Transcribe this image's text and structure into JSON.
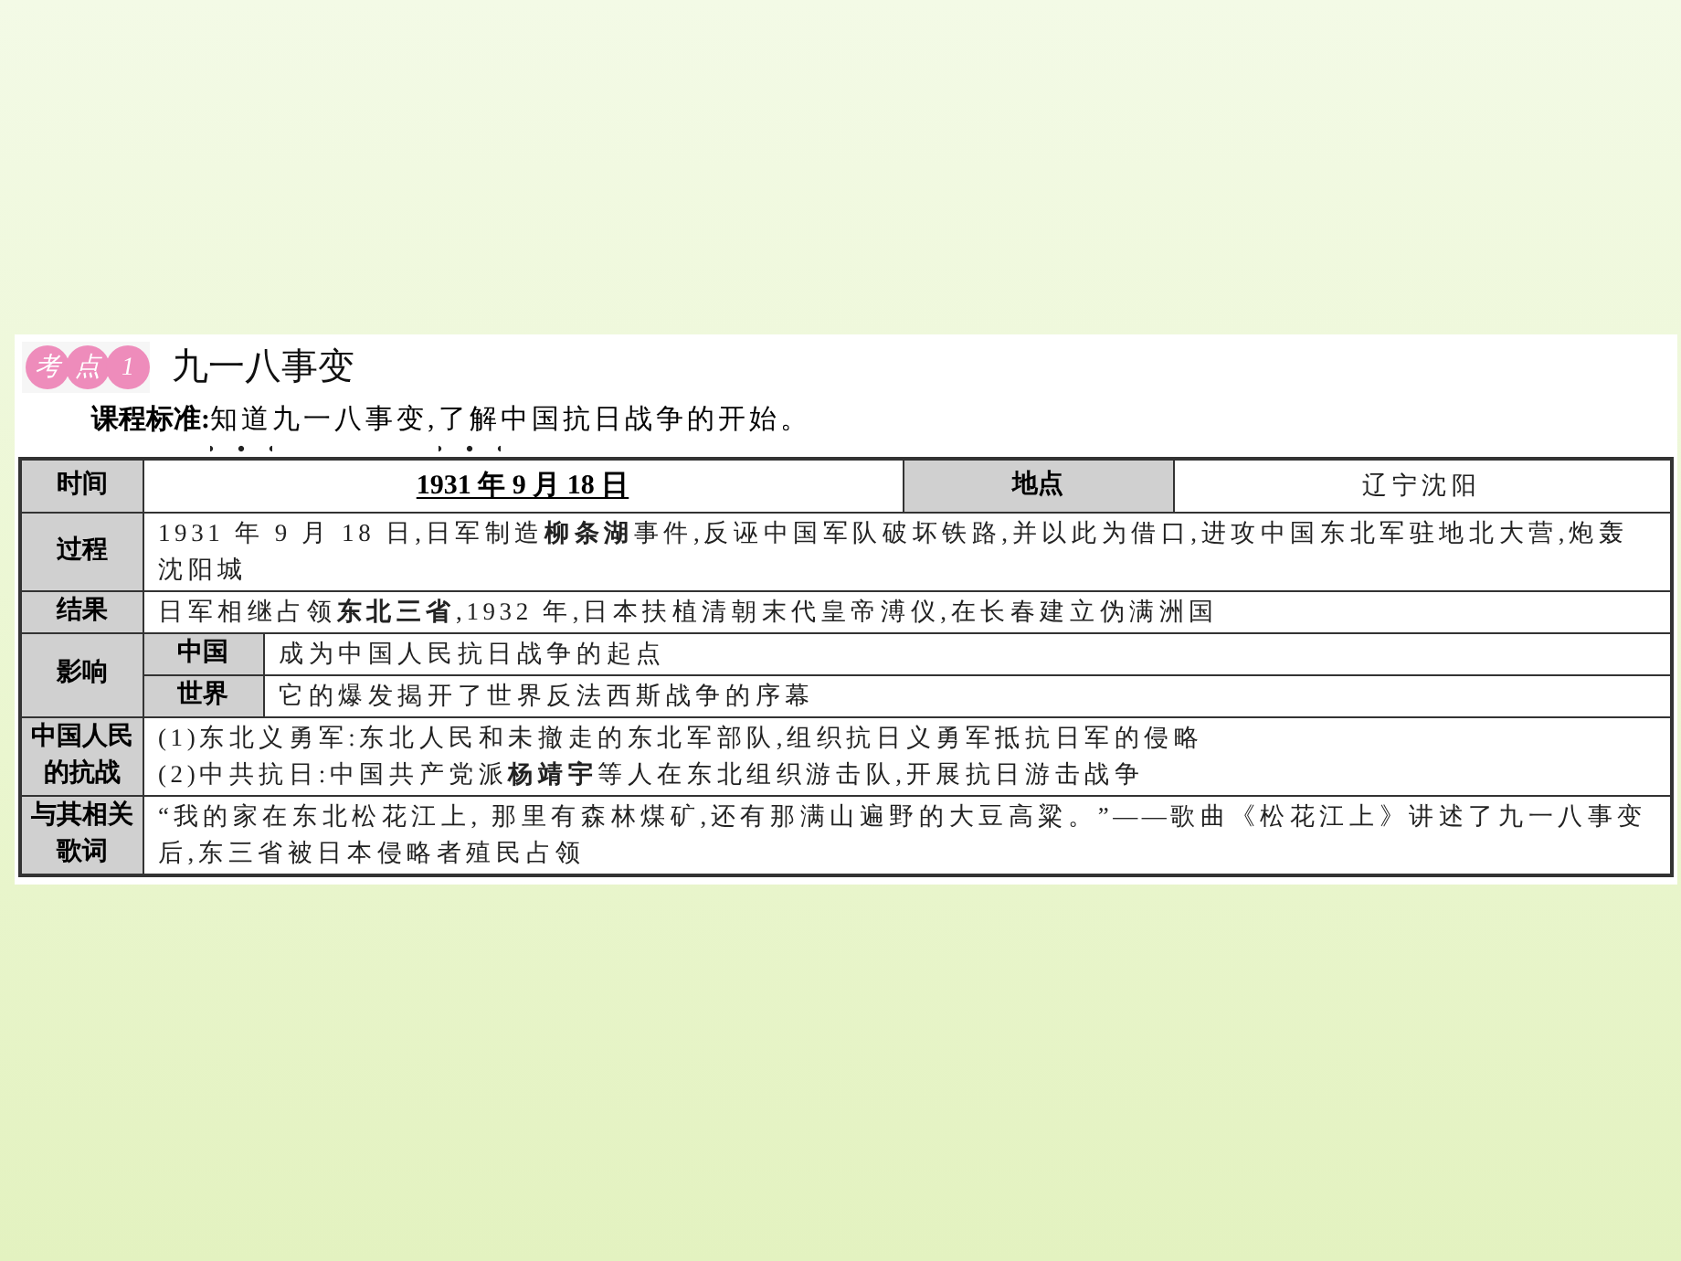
{
  "header": {
    "badge": [
      "考",
      "点",
      "1"
    ],
    "title": "九一八事变"
  },
  "standard": {
    "label": "课程标准:",
    "parts": [
      {
        "text": "知道",
        "emphasis": true
      },
      {
        "text": "九一八事变,",
        "emphasis": false
      },
      {
        "text": "了解",
        "emphasis": true
      },
      {
        "text": "中国抗日战争的开始。",
        "emphasis": false
      }
    ]
  },
  "table": {
    "time": {
      "label": "时间",
      "value": "1931 年 9 月 18 日",
      "place_label": "地点",
      "place": "辽宁沈阳"
    },
    "rows": [
      {
        "kind": "plain",
        "label": "过程",
        "lines": [
          "1931 年 9 月 18 日,日军制造**柳条湖**事件,反诬中国军队破坏铁路,并以此为借口,进攻中国东北军驻地北大营,炮轰沈阳城"
        ]
      },
      {
        "kind": "plain",
        "label": "结果",
        "lines": [
          "日军相继占领**东北三省**,1932 年,日本扶植清朝末代皇帝溥仪,在长春建立伪满洲国"
        ]
      },
      {
        "kind": "split",
        "label": "影响",
        "items": [
          {
            "label": "中国",
            "text": "成为中国人民抗日战争的起点"
          },
          {
            "label": "世界",
            "text": "它的爆发揭开了世界反法西斯战争的序幕"
          }
        ]
      },
      {
        "kind": "plain",
        "label": "中国人民的抗战",
        "lines": [
          "(1)东北义勇军:东北人民和未撤走的东北军部队,组织抗日义勇军抵抗日军的侵略",
          "(2)中共抗日:中国共产党派**杨靖宇**等人在东北组织游击队,开展抗日游击战争"
        ]
      },
      {
        "kind": "plain",
        "label": "与其相关歌词",
        "lines": [
          "“我的家在东北松花江上, 那里有森林煤矿,还有那满山遍野的大豆高粱。”——歌曲《松花江上》讲述了九一八事变后,东三省被日本侵略者殖民占领"
        ]
      }
    ]
  }
}
